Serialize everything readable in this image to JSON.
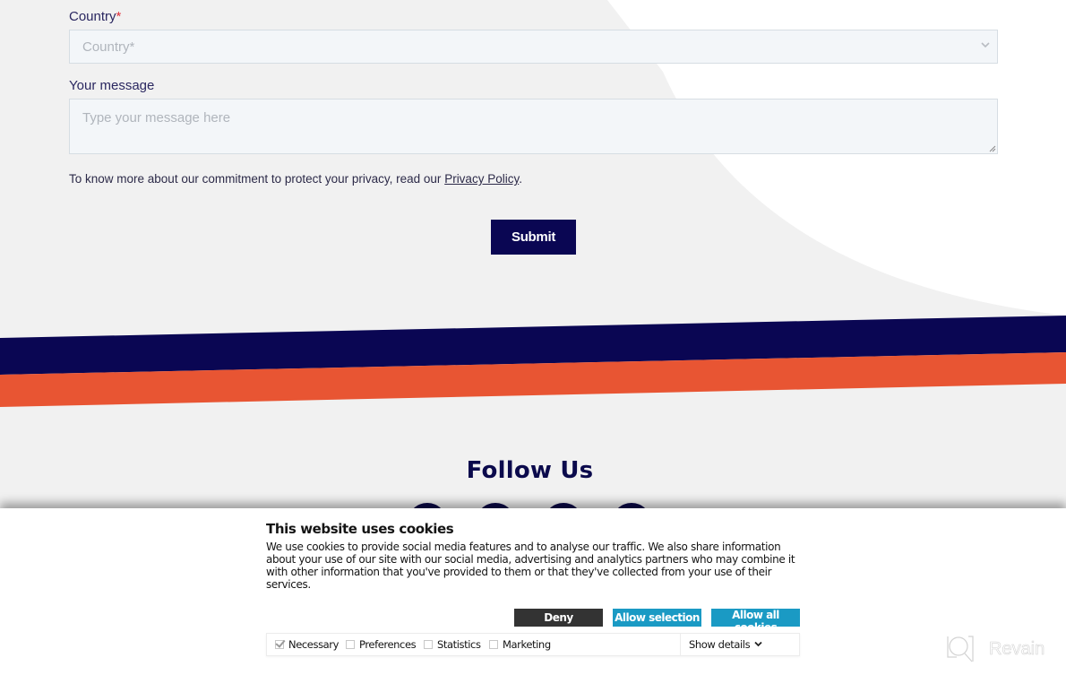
{
  "form": {
    "country_label": "Country",
    "required_mark": "*",
    "country_placeholder": "Country*",
    "message_label": "Your message",
    "message_placeholder": "Type your message here",
    "privacy_text": "To know more about our commitment to protect your privacy, read our ",
    "privacy_link": "Privacy Policy",
    "privacy_end": ".",
    "submit_label": "Submit"
  },
  "follow": {
    "title": "Follow Us",
    "icons": [
      "social-icon-1",
      "social-icon-2",
      "social-icon-3",
      "social-icon-4"
    ]
  },
  "cookie_banner": {
    "title": "This website uses cookies",
    "text": "We use cookies to provide social media features and to analyse our traffic. We also share information about your use of our site with our social media, advertising and analytics partners who may combine it with other information that you've provided to them or that they've collected from your use of their services.",
    "deny_label": "Deny",
    "allow_selection_label": "Allow selection",
    "allow_all_label": "Allow all cookies",
    "options": [
      {
        "label": "Necessary",
        "checked": true
      },
      {
        "label": "Preferences",
        "checked": false
      },
      {
        "label": "Statistics",
        "checked": false
      },
      {
        "label": "Marketing",
        "checked": false
      }
    ],
    "show_details_label": "Show details"
  },
  "watermark": {
    "label": "Revain"
  },
  "colors": {
    "navy": "#0a0653",
    "orange": "#e85533",
    "accent": "#1a9ac4",
    "deny": "#333333"
  }
}
